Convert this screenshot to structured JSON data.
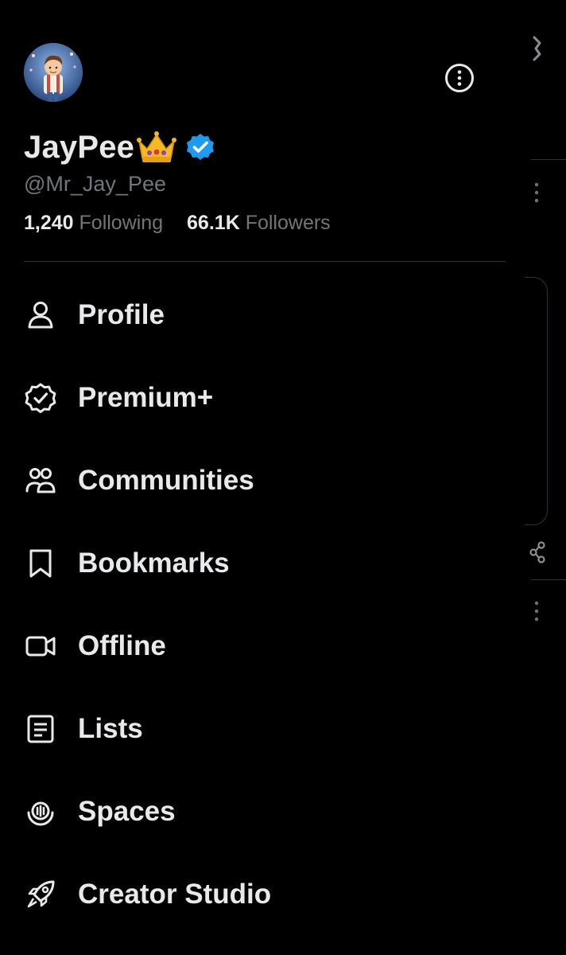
{
  "profile": {
    "display_name": "JayPee",
    "handle": "@Mr_Jay_Pee",
    "following_count": "1,240",
    "following_label": "Following",
    "followers_count": "66.1K",
    "followers_label": "Followers",
    "verified_color": "#1d9bf0"
  },
  "menu": {
    "items": [
      {
        "label": "Profile",
        "icon": "person-icon"
      },
      {
        "label": "Premium+",
        "icon": "verified-badge-icon"
      },
      {
        "label": "Communities",
        "icon": "communities-icon"
      },
      {
        "label": "Bookmarks",
        "icon": "bookmark-icon"
      },
      {
        "label": "Offline",
        "icon": "video-camera-icon"
      },
      {
        "label": "Lists",
        "icon": "list-icon"
      },
      {
        "label": "Spaces",
        "icon": "spaces-mic-icon"
      },
      {
        "label": "Creator Studio",
        "icon": "rocket-icon"
      }
    ]
  },
  "colors": {
    "background": "#000000",
    "primary_text": "#e7e9ea",
    "secondary_text": "#71767b",
    "divider": "#2f3336"
  }
}
